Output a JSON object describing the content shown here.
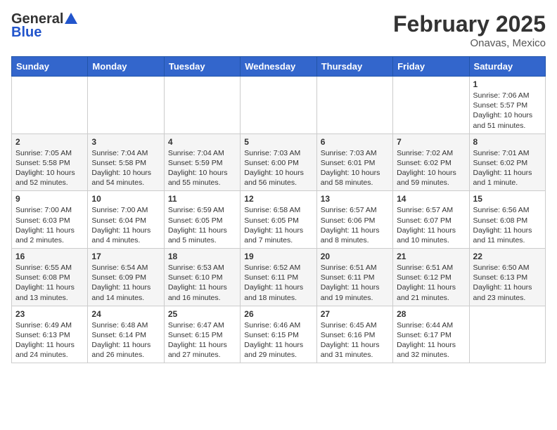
{
  "header": {
    "logo_general": "General",
    "logo_blue": "Blue",
    "title": "February 2025",
    "subtitle": "Onavas, Mexico"
  },
  "calendar": {
    "days_of_week": [
      "Sunday",
      "Monday",
      "Tuesday",
      "Wednesday",
      "Thursday",
      "Friday",
      "Saturday"
    ],
    "weeks": [
      [
        {
          "day": "",
          "info": ""
        },
        {
          "day": "",
          "info": ""
        },
        {
          "day": "",
          "info": ""
        },
        {
          "day": "",
          "info": ""
        },
        {
          "day": "",
          "info": ""
        },
        {
          "day": "",
          "info": ""
        },
        {
          "day": "1",
          "info": "Sunrise: 7:06 AM\nSunset: 5:57 PM\nDaylight: 10 hours and 51 minutes."
        }
      ],
      [
        {
          "day": "2",
          "info": "Sunrise: 7:05 AM\nSunset: 5:58 PM\nDaylight: 10 hours and 52 minutes."
        },
        {
          "day": "3",
          "info": "Sunrise: 7:04 AM\nSunset: 5:58 PM\nDaylight: 10 hours and 54 minutes."
        },
        {
          "day": "4",
          "info": "Sunrise: 7:04 AM\nSunset: 5:59 PM\nDaylight: 10 hours and 55 minutes."
        },
        {
          "day": "5",
          "info": "Sunrise: 7:03 AM\nSunset: 6:00 PM\nDaylight: 10 hours and 56 minutes."
        },
        {
          "day": "6",
          "info": "Sunrise: 7:03 AM\nSunset: 6:01 PM\nDaylight: 10 hours and 58 minutes."
        },
        {
          "day": "7",
          "info": "Sunrise: 7:02 AM\nSunset: 6:02 PM\nDaylight: 10 hours and 59 minutes."
        },
        {
          "day": "8",
          "info": "Sunrise: 7:01 AM\nSunset: 6:02 PM\nDaylight: 11 hours and 1 minute."
        }
      ],
      [
        {
          "day": "9",
          "info": "Sunrise: 7:00 AM\nSunset: 6:03 PM\nDaylight: 11 hours and 2 minutes."
        },
        {
          "day": "10",
          "info": "Sunrise: 7:00 AM\nSunset: 6:04 PM\nDaylight: 11 hours and 4 minutes."
        },
        {
          "day": "11",
          "info": "Sunrise: 6:59 AM\nSunset: 6:05 PM\nDaylight: 11 hours and 5 minutes."
        },
        {
          "day": "12",
          "info": "Sunrise: 6:58 AM\nSunset: 6:05 PM\nDaylight: 11 hours and 7 minutes."
        },
        {
          "day": "13",
          "info": "Sunrise: 6:57 AM\nSunset: 6:06 PM\nDaylight: 11 hours and 8 minutes."
        },
        {
          "day": "14",
          "info": "Sunrise: 6:57 AM\nSunset: 6:07 PM\nDaylight: 11 hours and 10 minutes."
        },
        {
          "day": "15",
          "info": "Sunrise: 6:56 AM\nSunset: 6:08 PM\nDaylight: 11 hours and 11 minutes."
        }
      ],
      [
        {
          "day": "16",
          "info": "Sunrise: 6:55 AM\nSunset: 6:08 PM\nDaylight: 11 hours and 13 minutes."
        },
        {
          "day": "17",
          "info": "Sunrise: 6:54 AM\nSunset: 6:09 PM\nDaylight: 11 hours and 14 minutes."
        },
        {
          "day": "18",
          "info": "Sunrise: 6:53 AM\nSunset: 6:10 PM\nDaylight: 11 hours and 16 minutes."
        },
        {
          "day": "19",
          "info": "Sunrise: 6:52 AM\nSunset: 6:11 PM\nDaylight: 11 hours and 18 minutes."
        },
        {
          "day": "20",
          "info": "Sunrise: 6:51 AM\nSunset: 6:11 PM\nDaylight: 11 hours and 19 minutes."
        },
        {
          "day": "21",
          "info": "Sunrise: 6:51 AM\nSunset: 6:12 PM\nDaylight: 11 hours and 21 minutes."
        },
        {
          "day": "22",
          "info": "Sunrise: 6:50 AM\nSunset: 6:13 PM\nDaylight: 11 hours and 23 minutes."
        }
      ],
      [
        {
          "day": "23",
          "info": "Sunrise: 6:49 AM\nSunset: 6:13 PM\nDaylight: 11 hours and 24 minutes."
        },
        {
          "day": "24",
          "info": "Sunrise: 6:48 AM\nSunset: 6:14 PM\nDaylight: 11 hours and 26 minutes."
        },
        {
          "day": "25",
          "info": "Sunrise: 6:47 AM\nSunset: 6:15 PM\nDaylight: 11 hours and 27 minutes."
        },
        {
          "day": "26",
          "info": "Sunrise: 6:46 AM\nSunset: 6:15 PM\nDaylight: 11 hours and 29 minutes."
        },
        {
          "day": "27",
          "info": "Sunrise: 6:45 AM\nSunset: 6:16 PM\nDaylight: 11 hours and 31 minutes."
        },
        {
          "day": "28",
          "info": "Sunrise: 6:44 AM\nSunset: 6:17 PM\nDaylight: 11 hours and 32 minutes."
        },
        {
          "day": "",
          "info": ""
        }
      ]
    ]
  }
}
